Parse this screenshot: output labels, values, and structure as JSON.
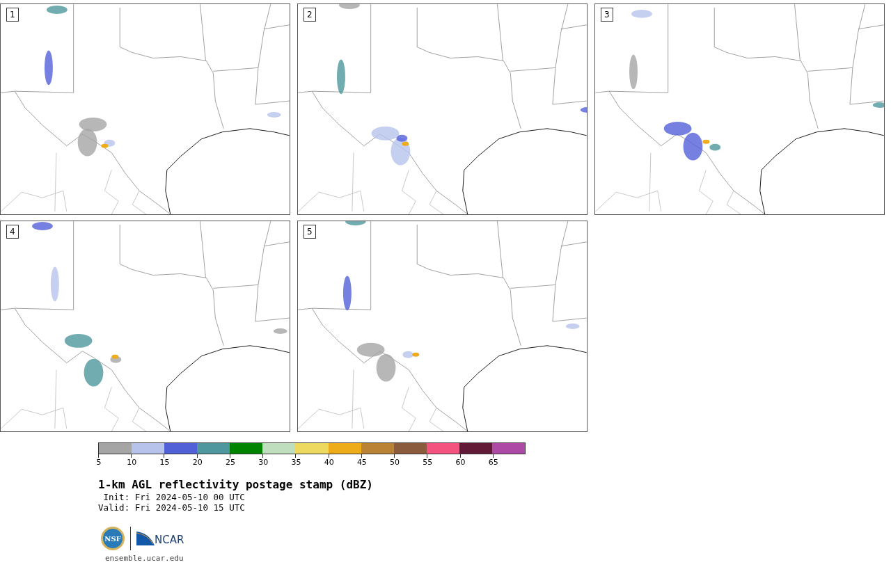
{
  "panels": [
    {
      "label": "1"
    },
    {
      "label": "2"
    },
    {
      "label": "3"
    },
    {
      "label": "4"
    },
    {
      "label": "5"
    }
  ],
  "colorbar": [
    {
      "tick": "5",
      "color": "#a5a5a5"
    },
    {
      "tick": "10",
      "color": "#b7c3eb"
    },
    {
      "tick": "15",
      "color": "#5260d8"
    },
    {
      "tick": "20",
      "color": "#4e979e"
    },
    {
      "tick": "25",
      "color": "#018300"
    },
    {
      "tick": "30",
      "color": "#bfdebe"
    },
    {
      "tick": "35",
      "color": "#eed960"
    },
    {
      "tick": "40",
      "color": "#eeac1a"
    },
    {
      "tick": "45",
      "color": "#b98234"
    },
    {
      "tick": "50",
      "color": "#8a5b3d"
    },
    {
      "tick": "55",
      "color": "#f4527f"
    },
    {
      "tick": "60",
      "color": "#621937"
    },
    {
      "tick": "65",
      "color": "#ad4aa6"
    }
  ],
  "title": "1-km AGL reflectivity postage stamp (dBZ)",
  "init": " Init: Fri 2024-05-10 00 UTC",
  "valid": "Valid: Fri 2024-05-10 15 UTC",
  "logos": {
    "nsf": "NSF",
    "ncar": "NCAR"
  },
  "footer_link": "ensemble.ucar.edu"
}
